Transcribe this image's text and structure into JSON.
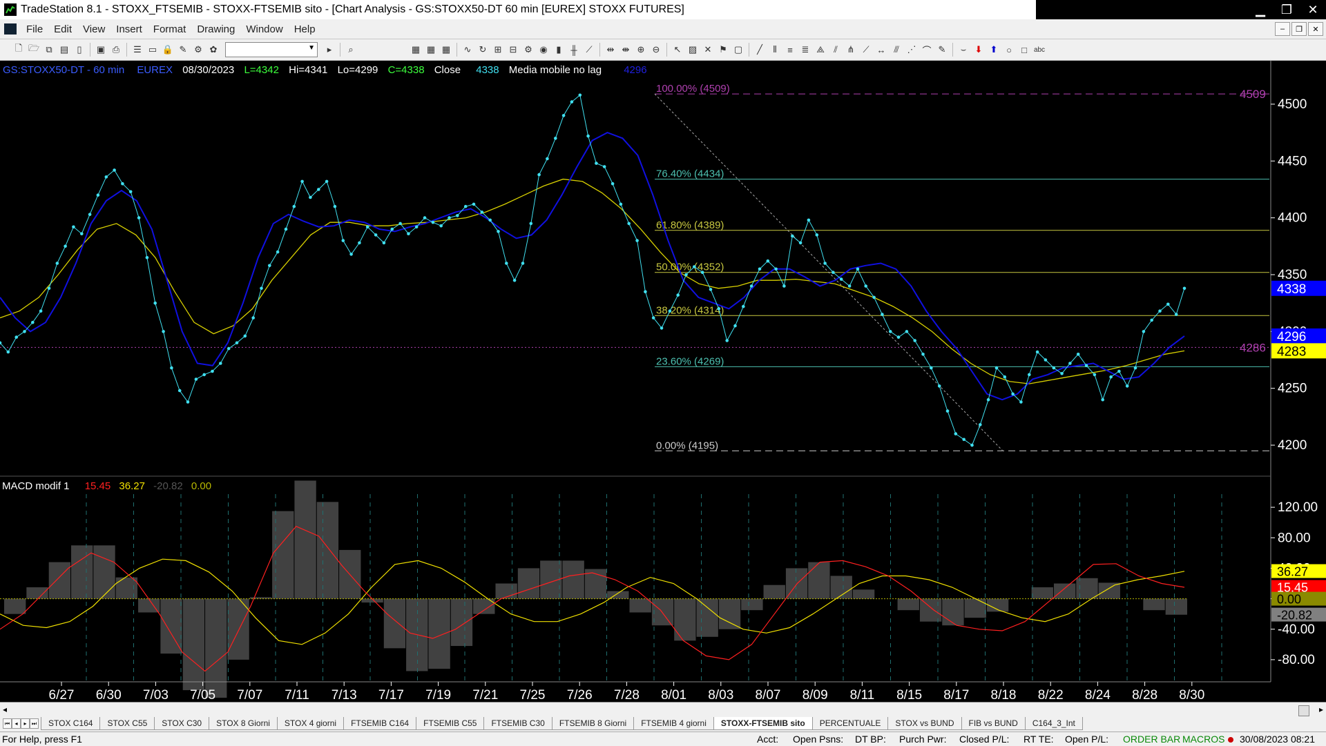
{
  "window": {
    "title": "TradeStation 8.1 - STOXX_FTSEMIB - STOXX-FTSEMIB sito - [Chart Analysis - GS:STOXX50-DT  60 min  [EUREX] STOXX FUTURES]",
    "min_label": "▁",
    "max_label": "❐",
    "close_label": "✕"
  },
  "menu": {
    "items": [
      "File",
      "Edit",
      "View",
      "Insert",
      "Format",
      "Drawing",
      "Window",
      "Help"
    ],
    "mdi_buttons": [
      "–",
      "❐",
      "✕"
    ]
  },
  "chart_header": {
    "symbol": "GS:STOXX50-DT - 60 min",
    "exchange": "EUREX",
    "date": "08/30/2023",
    "last": "L=4342",
    "hi": "Hi=4341",
    "lo": "Lo=4299",
    "close": "C=4338",
    "close_label": "Close",
    "close_value": "4338",
    "indicator_name": "Media mobile no lag",
    "indicator_value": "4296"
  },
  "macd_header": {
    "name": "MACD modif 1",
    "v1": "15.45",
    "v2": "36.27",
    "v3": "-20.82",
    "v4": "0.00"
  },
  "fib_levels": [
    {
      "label": "100.00% (4509)",
      "value": 4509
    },
    {
      "label": "76.40% (4434)",
      "value": 4434
    },
    {
      "label": "61.80% (4389)",
      "value": 4389
    },
    {
      "label": "50.00% (4352)",
      "value": 4352
    },
    {
      "label": "38.20% (4314)",
      "value": 4314
    },
    {
      "label": "23.60% (4269)",
      "value": 4269
    },
    {
      "label": "0.00% (4195)",
      "value": 4195
    }
  ],
  "price_axis_labels": [
    "4500",
    "4450",
    "4400",
    "4350",
    "4300",
    "4250",
    "4200"
  ],
  "price_tags": [
    {
      "label": "4509",
      "value": 4509,
      "color": "#b040b0",
      "kind": "text"
    },
    {
      "label": "4286",
      "value": 4286,
      "color": "#b040b0",
      "kind": "text"
    },
    {
      "label": "4338",
      "value": 4338,
      "color": "#ffffff",
      "bg": "#0000ff",
      "kind": "box"
    },
    {
      "label": "4296",
      "value": 4296,
      "color": "#ffffff",
      "bg": "#0000ff",
      "kind": "box"
    },
    {
      "label": "4283",
      "value": 4283,
      "color": "#000000",
      "bg": "#ffff00",
      "kind": "box"
    }
  ],
  "macd_axis_labels": [
    "120.00",
    "80.00",
    "40.00",
    "0.00",
    "-40.00",
    "-80.00"
  ],
  "macd_tags": [
    {
      "label": "36.27",
      "value": 36.27,
      "color": "#000000",
      "bg": "#ffff00"
    },
    {
      "label": "15.45",
      "value": 15.45,
      "color": "#ffffff",
      "bg": "#ff0000"
    },
    {
      "label": "0.00",
      "value": 0.0,
      "color": "#000000",
      "bg": "#8a8a00"
    },
    {
      "label": "-20.82",
      "value": -20.82,
      "color": "#000000",
      "bg": "#808080"
    }
  ],
  "date_axis_labels": [
    "6/27",
    "6/30",
    "7/03",
    "7/05",
    "7/07",
    "7/11",
    "7/13",
    "7/17",
    "7/19",
    "7/21",
    "7/25",
    "7/26",
    "7/28",
    "8/01",
    "8/03",
    "8/07",
    "8/09",
    "8/11",
    "8/15",
    "8/17",
    "8/18",
    "8/22",
    "8/24",
    "8/28",
    "8/30"
  ],
  "tabs": [
    "STOX C164",
    "STOX C55",
    "STOX C30",
    "STOX 8 Giorni",
    "STOX 4 giorni",
    "FTSEMIB C164",
    "FTSEMIB C55",
    "FTSEMIB C30",
    "FTSEMIB 8 Giorni",
    "FTSEMIB 4 giorni",
    "STOXX-FTSEMIB sito",
    "PERCENTUALE",
    "STOX vs BUND",
    "FIB vs BUND",
    "C164_3_Int"
  ],
  "active_tab": "STOXX-FTSEMIB sito",
  "status": {
    "help": "For Help, press F1",
    "acct": "Acct:",
    "open_psns": "Open Psns:",
    "dt_bp": "DT BP:",
    "purch_pwr": "Purch Pwr:",
    "closed_pl": "Closed P/L:",
    "rt_te": "RT TE:",
    "open_pl": "Open P/L:",
    "order_bar": "ORDER BAR",
    "macros": "MACROS",
    "datetime": "30/08/2023 08:21"
  },
  "colors": {
    "price_dots": "#40e0f0",
    "ma_blue": "#1010e0",
    "ma_yellow": "#d8d000",
    "macd_red": "#ff2020",
    "macd_yellow": "#f0e000",
    "hist": "#909090",
    "fib_top": "#b040b0",
    "fib_mid": "#c8c840",
    "fib_low": "#4dc0b0",
    "axis_text": "#ffffff"
  },
  "chart_data": {
    "type": "line",
    "series": [
      {
        "name": "Close",
        "values": [
          4290,
          4282,
          4295,
          4300,
          4308,
          4318,
          4338,
          4360,
          4375,
          4392,
          4386,
          4403,
          4420,
          4436,
          4442,
          4430,
          4423,
          4400,
          4365,
          4325,
          4300,
          4268,
          4248,
          4238,
          4258,
          4262,
          4265,
          4272,
          4285,
          4290,
          4296,
          4312,
          4338,
          4358,
          4370,
          4390,
          4410,
          4432,
          4418,
          4425,
          4432,
          4410,
          4380,
          4368,
          4378,
          4392,
          4385,
          4378,
          4390,
          4395,
          4386,
          4392,
          4400,
          4396,
          4393,
          4400,
          4402,
          4410,
          4412,
          4405,
          4398,
          4388,
          4360,
          4345,
          4360,
          4395,
          4438,
          4452,
          4470,
          4490,
          4502,
          4508,
          4472,
          4448,
          4445,
          4430,
          4412,
          4395,
          4380,
          4335,
          4312,
          4303,
          4318,
          4332,
          4350,
          4357,
          4352,
          4337,
          4320,
          4292,
          4305,
          4322,
          4340,
          4355,
          4362,
          4355,
          4340,
          4384,
          4378,
          4398,
          4385,
          4360,
          4352,
          4346,
          4340,
          4355,
          4340,
          4330,
          4315,
          4300,
          4295,
          4300,
          4292,
          4280,
          4268,
          4252,
          4230,
          4210,
          4205,
          4200,
          4218,
          4240,
          4268,
          4260,
          4245,
          4238,
          4262,
          4282,
          4275,
          4268,
          4263,
          4272,
          4280,
          4270,
          4262,
          4240,
          4260,
          4265,
          4252,
          4268,
          4300,
          4310,
          4318,
          4324,
          4315,
          4338
        ]
      },
      {
        "name": "Media mobile no lag",
        "values": [
          4330,
          4312,
          4300,
          4308,
          4330,
          4360,
          4395,
          4415,
          4424,
          4415,
          4390,
          4345,
          4300,
          4272,
          4270,
          4290,
          4325,
          4365,
          4395,
          4403,
          4397,
          4392,
          4393,
          4398,
          4396,
          4390,
          4388,
          4392,
          4395,
          4400,
          4405,
          4408,
          4400,
          4390,
          4382,
          4385,
          4398,
          4420,
          4445,
          4468,
          4475,
          4470,
          4455,
          4420,
          4380,
          4345,
          4330,
          4325,
          4320,
          4330,
          4345,
          4355,
          4355,
          4348,
          4340,
          4345,
          4355,
          4358,
          4360,
          4355,
          4340,
          4318,
          4300,
          4285,
          4265,
          4245,
          4240,
          4245,
          4258,
          4262,
          4268,
          4270,
          4272,
          4265,
          4258,
          4260,
          4272,
          4286,
          4296
        ]
      },
      {
        "name": "Media mobile",
        "values": [
          4312,
          4318,
          4330,
          4350,
          4372,
          4390,
          4395,
          4385,
          4365,
          4335,
          4308,
          4298,
          4305,
          4320,
          4345,
          4365,
          4385,
          4396,
          4396,
          4393,
          4393,
          4395,
          4396,
          4398,
          4400,
          4405,
          4412,
          4420,
          4428,
          4434,
          4432,
          4422,
          4408,
          4390,
          4370,
          4352,
          4342,
          4338,
          4340,
          4345,
          4345,
          4346,
          4344,
          4342,
          4336,
          4330,
          4322,
          4312,
          4300,
          4285,
          4272,
          4262,
          4256,
          4254,
          4257,
          4260,
          4263,
          4266,
          4270,
          4275,
          4280,
          4283
        ]
      }
    ],
    "ylim": [
      4180,
      4520
    ],
    "macd": {
      "ylim": [
        -100,
        140
      ],
      "red": [
        -40,
        -20,
        10,
        40,
        60,
        48,
        22,
        -20,
        -70,
        -95,
        -70,
        -10,
        60,
        95,
        82,
        44,
        10,
        -20,
        -45,
        -52,
        -40,
        -20,
        0,
        10,
        20,
        30,
        34,
        25,
        10,
        -15,
        -55,
        -75,
        -80,
        -60,
        -20,
        20,
        48,
        50,
        42,
        30,
        10,
        -15,
        -35,
        -40,
        -42,
        -30,
        -5,
        20,
        45,
        46,
        30,
        20,
        15
      ],
      "yellow": [
        -20,
        -35,
        -38,
        -30,
        -10,
        20,
        40,
        52,
        50,
        35,
        10,
        -25,
        -55,
        -60,
        -45,
        -20,
        15,
        45,
        50,
        40,
        22,
        0,
        -20,
        -30,
        -30,
        -20,
        -5,
        15,
        28,
        20,
        0,
        -25,
        -40,
        -45,
        -38,
        -20,
        0,
        20,
        30,
        30,
        25,
        15,
        0,
        -15,
        -25,
        -30,
        -20,
        0,
        18,
        25,
        30,
        36
      ],
      "hist": [
        -20,
        15,
        48,
        70,
        70,
        28,
        -18,
        -72,
        -120,
        -130,
        -80,
        2,
        115,
        155,
        127,
        64,
        -5,
        -65,
        -95,
        -92,
        -62,
        -20,
        20,
        40,
        50,
        50,
        39,
        10,
        -18,
        -35,
        -55,
        -50,
        -40,
        -15,
        18,
        40,
        48,
        30,
        12,
        0,
        -15,
        -30,
        -35,
        -25,
        -17,
        0,
        15,
        20,
        27,
        21,
        0,
        -15,
        -21
      ]
    },
    "ma_windows": "60 min"
  }
}
